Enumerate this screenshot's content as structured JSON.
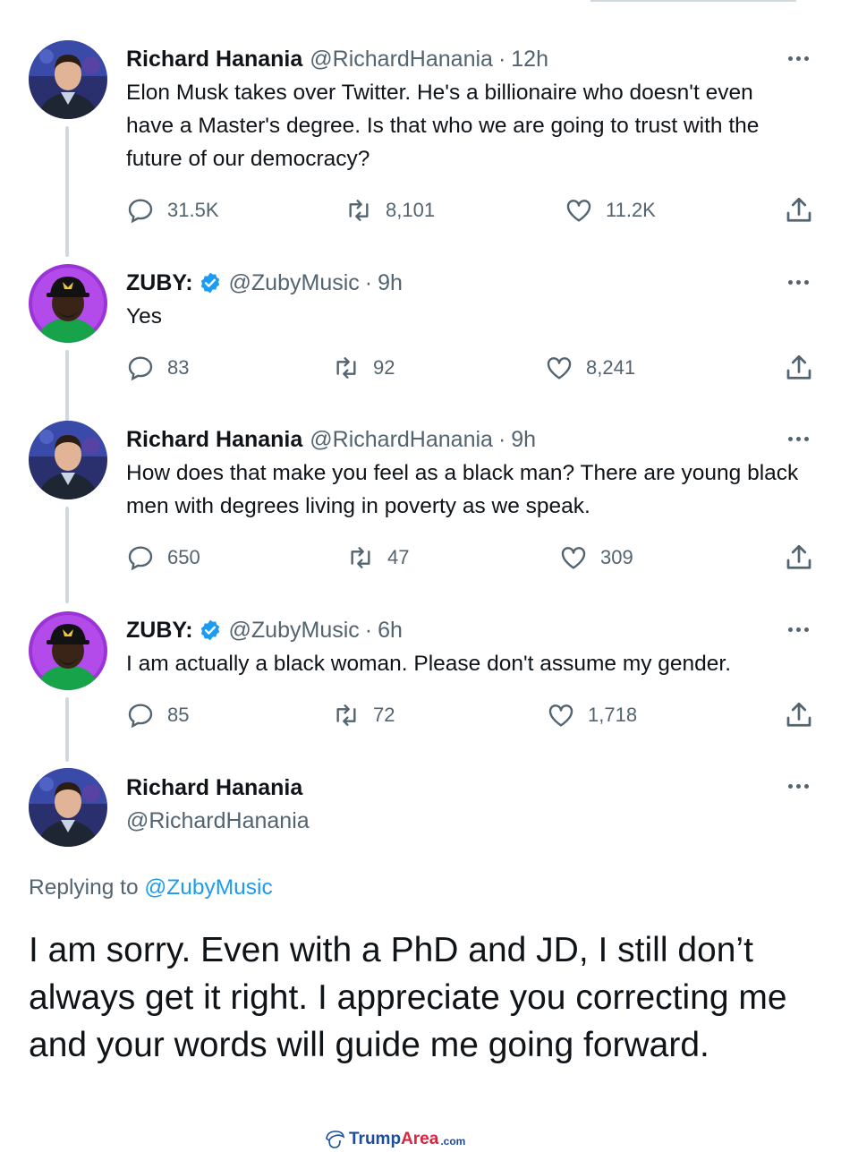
{
  "tweets": [
    {
      "name": "Richard Hanania",
      "handle": "@RichardHanania",
      "time": "12h",
      "text": "Elon Musk takes over Twitter. He's a billionaire who doesn't even have a Master's degree. Is that who we are going to trust with the future of our democracy?",
      "replies": "31.5K",
      "retweets": "8,101",
      "likes": "11.2K"
    },
    {
      "name": "ZUBY:",
      "handle": "@ZubyMusic",
      "time": "9h",
      "verified": true,
      "text": "Yes",
      "replies": "83",
      "retweets": "92",
      "likes": "8,241"
    },
    {
      "name": "Richard Hanania",
      "handle": "@RichardHanania",
      "time": "9h",
      "text": "How does that make you feel as a black man? There are young black men with degrees living in poverty as we speak.",
      "replies": "650",
      "retweets": "47",
      "likes": "309"
    },
    {
      "name": "ZUBY:",
      "handle": "@ZubyMusic",
      "time": "6h",
      "verified": true,
      "text": "I am actually a black woman. Please don't assume my gender.",
      "replies": "85",
      "retweets": "72",
      "likes": "1,718"
    }
  ],
  "main_tweet": {
    "name": "Richard Hanania",
    "handle": "@RichardHanania",
    "replying_label": "Replying to",
    "replying_handle": "@ZubyMusic",
    "text": "I am sorry. Even with a PhD and JD, I still don’t always get it right. I appreciate you correcting me and your words will guide me going forward."
  },
  "watermark": {
    "part1": "Trump",
    "part2": "Area",
    "part3": ".com"
  },
  "colors": {
    "text": "#0f1419",
    "secondary": "#536471",
    "accent": "#1d9bf0",
    "thread_line": "#cfd9de"
  },
  "icons": [
    "reply-icon",
    "retweet-icon",
    "like-icon",
    "share-icon",
    "more-icon",
    "verified-icon"
  ]
}
